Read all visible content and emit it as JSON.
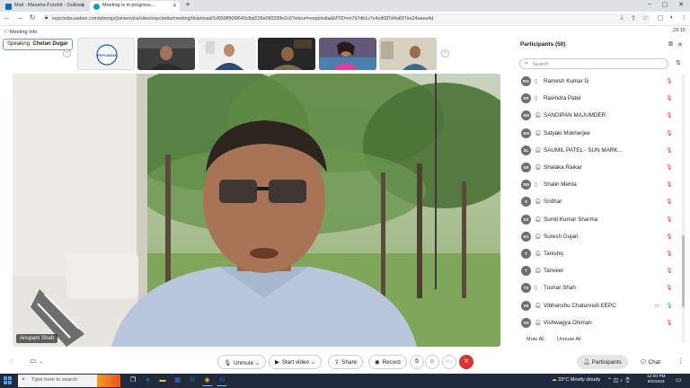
{
  "browser": {
    "tabs": [
      {
        "label": "Mail - Mansha Purohit - Outlook",
        "favicon_color": "#0f6cbd"
      },
      {
        "label": "Meeting is in progress...",
        "favicon_color": "#00a0d1"
      }
    ],
    "new_tab": "+",
    "window_controls": {
      "minimize": "–",
      "maximize": "▢",
      "close": "✕"
    },
    "address": "eepcindia.webex.com/wbxmjs/joinservice/sites/eepcindia/meeting/download/1d950ff50f9643c8af228e060339e2c6?siteurl=eepcindia&MTID=m7d7db1c7e4cd687d4af0f7ae24eaea4d"
  },
  "meeting": {
    "info_label": "Meeting Info",
    "time": "23:15",
    "speaking_prefix": "Speaking:",
    "speaking_name": "Chetan Dugar",
    "thumbnails": [
      {
        "kind": "logo",
        "text": "EEPCINDIA"
      },
      {
        "kind": "person",
        "bg": "#4a4a4a",
        "shirt": "#3b3b3b"
      },
      {
        "kind": "person",
        "bg": "#f2f2f2",
        "shirt": "#2d4a78"
      },
      {
        "kind": "person",
        "bg": "#2a2a2a",
        "shirt": "#7a6a55"
      },
      {
        "kind": "person",
        "bg": "#5a4f6e",
        "shirt": "#e03c9a"
      },
      {
        "kind": "person",
        "bg": "#d9d2c3",
        "shirt": "#3c6a8a"
      }
    ],
    "active_speaker": "Anupam Shah"
  },
  "participants": {
    "title": "Participants (50)",
    "search_placeholder": "Search",
    "list": [
      {
        "initials": "RG",
        "name": "Ramesh Kumar G",
        "device": "phone",
        "muted": true,
        "video": false
      },
      {
        "initials": "RP",
        "name": "Ravindra Patel",
        "device": "phone",
        "muted": true,
        "video": false
      },
      {
        "initials": "SM",
        "name": "SANDIPAN MAJUMDER",
        "device": "headset",
        "muted": true,
        "video": false
      },
      {
        "initials": "SM",
        "name": "Satyaki Mukherjee",
        "device": "headset",
        "muted": true,
        "video": false
      },
      {
        "initials": "SL",
        "name": "SAUMIL PATEL - SUN MARK...",
        "device": "headset",
        "muted": true,
        "video": false
      },
      {
        "initials": "SR",
        "name": "Shalaka Raikar",
        "device": "headset",
        "muted": true,
        "video": false
      },
      {
        "initials": "SM",
        "name": "Shalin Mehta",
        "device": "phone",
        "muted": true,
        "video": false
      },
      {
        "initials": "S",
        "name": "Sridhar",
        "device": "headset",
        "muted": true,
        "video": false
      },
      {
        "initials": "SS",
        "name": "Sumit Kumar Sharma",
        "device": "headset",
        "muted": true,
        "video": false
      },
      {
        "initials": "SG",
        "name": "Suresh Gujari",
        "device": "headset",
        "muted": true,
        "video": false
      },
      {
        "initials": "T",
        "name": "Tanishq",
        "device": "headset",
        "muted": true,
        "video": false
      },
      {
        "initials": "T",
        "name": "Tanveer",
        "device": "headset",
        "muted": true,
        "video": false
      },
      {
        "initials": "TS",
        "name": "Tushar Shah",
        "device": "phone",
        "muted": true,
        "video": false
      },
      {
        "initials": "VE",
        "name": "Vibhanshu Chaturvedi EEPC",
        "device": "headset",
        "muted": false,
        "video": true
      },
      {
        "initials": "VD",
        "name": "Vishwagya Dhiman",
        "device": "headset",
        "muted": true,
        "video": false
      }
    ],
    "mute_all": "Mute All",
    "unmute_all": "Unmute All"
  },
  "controls": {
    "unmute": "Unmute",
    "start_video": "Start video",
    "share": "Share",
    "record": "Record",
    "participants": "Participants",
    "chat": "Chat",
    "more": "···",
    "leave": "✕"
  },
  "taskbar": {
    "search_placeholder": "Type here to search",
    "weather": "33°C  Mostly cloudy",
    "time": "12:00 PM",
    "date": "8/2/2023",
    "apps": [
      {
        "name": "task-view",
        "color": "#ffffff",
        "glyph": "❐"
      },
      {
        "name": "edge",
        "color": "#1fa2d6",
        "glyph": "e"
      },
      {
        "name": "file-explorer",
        "color": "#f3c13a",
        "glyph": "▬"
      },
      {
        "name": "store",
        "color": "#3a7bd5",
        "glyph": "▦"
      },
      {
        "name": "mail",
        "color": "#1d6ad1",
        "glyph": "✉"
      },
      {
        "name": "chrome",
        "color": "#e6b81f",
        "glyph": "◉"
      },
      {
        "name": "word",
        "color": "#2b5cb8",
        "glyph": "W"
      }
    ]
  }
}
